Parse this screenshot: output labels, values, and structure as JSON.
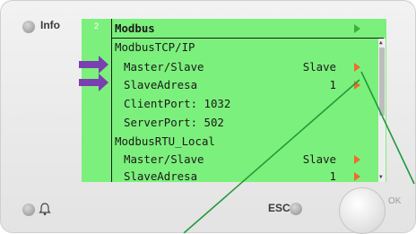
{
  "panel": {
    "info_label": "Info",
    "esc_label": "ESC",
    "ok_label": "OK"
  },
  "screen": {
    "page_number": "2",
    "title": "Modbus",
    "rows": [
      {
        "label": "ModbusTCP/IP",
        "value": "",
        "arrow": false
      },
      {
        "label": "Master/Slave",
        "value": "Slave",
        "arrow": true
      },
      {
        "label": "SlaveAdresa",
        "value": "1",
        "arrow": true
      },
      {
        "label": "ClientPort: 1032",
        "value": "",
        "arrow": false
      },
      {
        "label": "ServerPort: 502",
        "value": "",
        "arrow": false
      },
      {
        "label": "ModbusRTU_Local",
        "value": "",
        "arrow": false
      },
      {
        "label": "Master/Slave",
        "value": "Slave",
        "arrow": true
      },
      {
        "label": "SlaveAdresa",
        "value": "1",
        "arrow": true
      }
    ]
  },
  "colors": {
    "screen_bg": "#7cf07c",
    "edit_arrow": "#ef6b2a",
    "nav_arrow": "#3cae3c",
    "pointer_arrow": "#7a3fb0",
    "annotation_line": "#1f9a3a"
  },
  "icons": [
    "bell-icon",
    "pointer-arrow-icon"
  ]
}
